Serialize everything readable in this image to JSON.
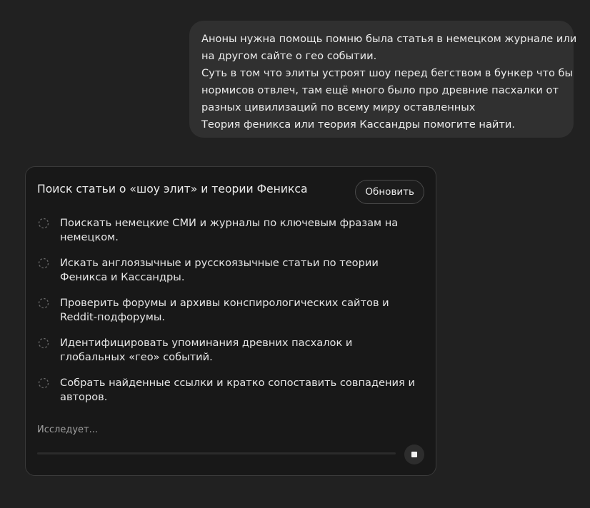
{
  "user_message": {
    "lines": [
      "Аноны нужна помощь помню была статья в немецком журнале или",
      "на другом сайте о гео событии.",
      "Суть в том что элиты устроят шоу перед бегством в бункер что бы",
      "нормисов отвлеч, там ещё много было про древние пасхалки от",
      "разных цивилизаций по всему миру оставленных",
      "Теория феникса или теория Кассандры помогите найти."
    ]
  },
  "task_card": {
    "title": "Поиск статьи о «шоу элит» и теории Феникса",
    "refresh_label": "Обновить",
    "steps": [
      {
        "text": "Поискать немецкие СМИ и журналы по ключевым фразам на немецком.",
        "status": "pending"
      },
      {
        "text": "Искать англоязычные и русскоязычные статьи по теории Феникса и Кассандры.",
        "status": "pending"
      },
      {
        "text": "Проверить форумы и архивы конспирологических сайтов и Reddit-подфорумы.",
        "status": "pending"
      },
      {
        "text": "Идентифицировать упоминания древних пасхалок и глобальных «гео» событий.",
        "status": "pending"
      },
      {
        "text": "Собрать найденные ссылки и кратко сопоставить совпадения и авторов.",
        "status": "pending"
      }
    ],
    "status_text": "Исследует...",
    "progress": 0,
    "stop_icon": "stop-icon",
    "pending_icon": "dashed-circle-icon"
  }
}
